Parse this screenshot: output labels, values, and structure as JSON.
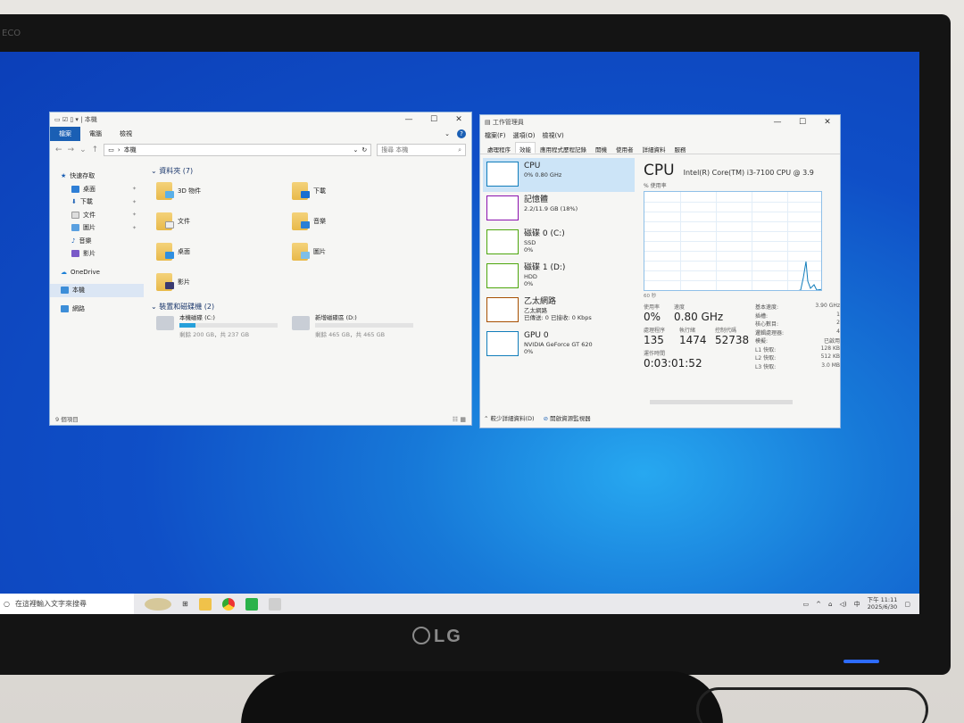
{
  "monitor": {
    "brand": "LG",
    "corner_text": "ECO"
  },
  "explorer": {
    "title": "本機",
    "ribbon_tabs": [
      "檔案",
      "電腦",
      "檢視"
    ],
    "help": "?",
    "address": "本機",
    "search_placeholder": "搜尋 本機",
    "nav": {
      "quick_access": "快速存取",
      "items": [
        {
          "label": "桌面",
          "icon": "desktop-icon",
          "pinned": true
        },
        {
          "label": "下載",
          "icon": "download-icon",
          "pinned": true
        },
        {
          "label": "文件",
          "icon": "document-icon",
          "pinned": true
        },
        {
          "label": "圖片",
          "icon": "picture-icon",
          "pinned": true
        },
        {
          "label": "音樂",
          "icon": "music-icon",
          "pinned": false
        },
        {
          "label": "影片",
          "icon": "video-icon",
          "pinned": false
        }
      ],
      "onedrive": "OneDrive",
      "this_pc": "本機",
      "network": "網路"
    },
    "folders_header": "資料夾 (7)",
    "folders": [
      "3D 物件",
      "下載",
      "文件",
      "音樂",
      "桌面",
      "圖片",
      "影片"
    ],
    "drives_header": "裝置和磁碟機 (2)",
    "drives": [
      {
        "name": "本機磁碟 (C:)",
        "free": "剩餘 200 GB，共 237 GB",
        "used_fraction": 0.16
      },
      {
        "name": "新增磁碟區 (D:)",
        "free": "剩餘 465 GB，共 465 GB",
        "used_fraction": 0.0
      }
    ],
    "status": "9 個項目"
  },
  "taskmgr": {
    "title": "工作管理員",
    "menu": [
      "檔案(F)",
      "選項(O)",
      "檢視(V)"
    ],
    "tabs": [
      "處理程序",
      "效能",
      "應用程式歷程記錄",
      "開機",
      "使用者",
      "詳細資料",
      "服務"
    ],
    "active_tab": "效能",
    "resources": [
      {
        "name": "CPU",
        "line1": "0% 0.80 GHz",
        "line2": "",
        "color": "#117dbb"
      },
      {
        "name": "記憶體",
        "line1": "2.2/11.9 GB (18%)",
        "line2": "",
        "color": "#8b12ae"
      },
      {
        "name": "磁碟 0 (C:)",
        "line1": "SSD",
        "line2": "0%",
        "color": "#4da60c"
      },
      {
        "name": "磁碟 1 (D:)",
        "line1": "HDD",
        "line2": "0%",
        "color": "#4da60c"
      },
      {
        "name": "乙太網路",
        "line1": "乙太網路",
        "line2": "已傳送: 0 已接收: 0 Kbps",
        "color": "#a74f01"
      },
      {
        "name": "GPU 0",
        "line1": "NVIDIA GeForce GT 620",
        "line2": "0%",
        "color": "#117dbb"
      }
    ],
    "cpu": {
      "heading": "CPU",
      "model": "Intel(R) Core(TM) i3-7100 CPU @ 3.9",
      "util_label": "% 使用率",
      "seconds_label": "60 秒",
      "stats": {
        "util_k": "使用率",
        "util_v": "0%",
        "speed_k": "速度",
        "speed_v": "0.80 GHz",
        "proc_k": "處理程序",
        "proc_v": "135",
        "threads_k": "執行緒",
        "threads_v": "1474",
        "handles_k": "控制代碼",
        "handles_v": "52738",
        "uptime_k": "運作時間",
        "uptime_v": "0:03:01:52"
      },
      "specs": [
        {
          "k": "基本速度:",
          "v": "3.90 GHz"
        },
        {
          "k": "插槽:",
          "v": "1"
        },
        {
          "k": "核心數目:",
          "v": "2"
        },
        {
          "k": "邏輯處理器:",
          "v": "4"
        },
        {
          "k": "模擬:",
          "v": "已啟用"
        },
        {
          "k": "L1 快取:",
          "v": "128 KB"
        },
        {
          "k": "L2 快取:",
          "v": "512 KB"
        },
        {
          "k": "L3 快取:",
          "v": "3.0 MB"
        }
      ]
    },
    "footer": {
      "fewer": "較少詳細資料(D)",
      "monitor": "開啟資源監視器"
    }
  },
  "taskbar": {
    "search_placeholder": "在這裡輸入文字來搜尋",
    "time": "下午 11:11",
    "date": "2025/6/30",
    "ime": "中"
  }
}
